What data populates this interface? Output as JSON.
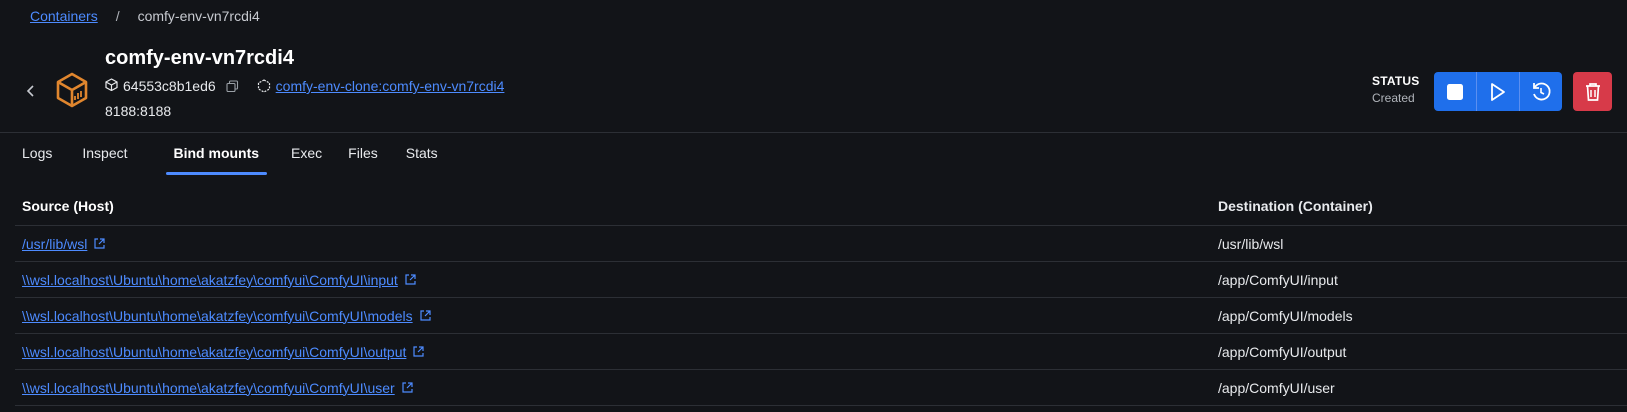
{
  "breadcrumb": {
    "parent": "Containers",
    "separator": "/",
    "current": "comfy-env-vn7rcdi4"
  },
  "header": {
    "title": "comfy-env-vn7rcdi4",
    "container_id": "64553c8b1ed6",
    "image_link": "comfy-env-clone:comfy-env-vn7rcdi4",
    "port": "8188:8188",
    "icon": "container-box-icon"
  },
  "status": {
    "label": "STATUS",
    "value": "Created"
  },
  "actions": {
    "stop": "stop-icon",
    "start": "play-icon",
    "restart": "restart-icon",
    "delete": "trash-icon"
  },
  "tabs": [
    {
      "label": "Logs"
    },
    {
      "label": "Inspect"
    },
    {
      "label": "Bind mounts",
      "active": true
    },
    {
      "label": "Exec"
    },
    {
      "label": "Files"
    },
    {
      "label": "Stats"
    }
  ],
  "table": {
    "headers": {
      "source": "Source (Host)",
      "destination": "Destination (Container)"
    },
    "rows": [
      {
        "source": "/usr/lib/wsl",
        "destination": "/usr/lib/wsl"
      },
      {
        "source": "\\\\wsl.localhost\\Ubuntu\\home\\akatzfey\\comfyui\\ComfyUI\\input",
        "destination": "/app/ComfyUI/input"
      },
      {
        "source": "\\\\wsl.localhost\\Ubuntu\\home\\akatzfey\\comfyui\\ComfyUI\\models",
        "destination": "/app/ComfyUI/models"
      },
      {
        "source": "\\\\wsl.localhost\\Ubuntu\\home\\akatzfey\\comfyui\\ComfyUI\\output",
        "destination": "/app/ComfyUI/output"
      },
      {
        "source": "\\\\wsl.localhost\\Ubuntu\\home\\akatzfey\\comfyui\\ComfyUI\\user",
        "destination": "/app/ComfyUI/user"
      }
    ]
  },
  "colors": {
    "background": "#121418",
    "link": "#4d8bff",
    "primary_button": "#1f6feb",
    "danger_button": "#d73a49",
    "container_icon": "#e0862e"
  }
}
